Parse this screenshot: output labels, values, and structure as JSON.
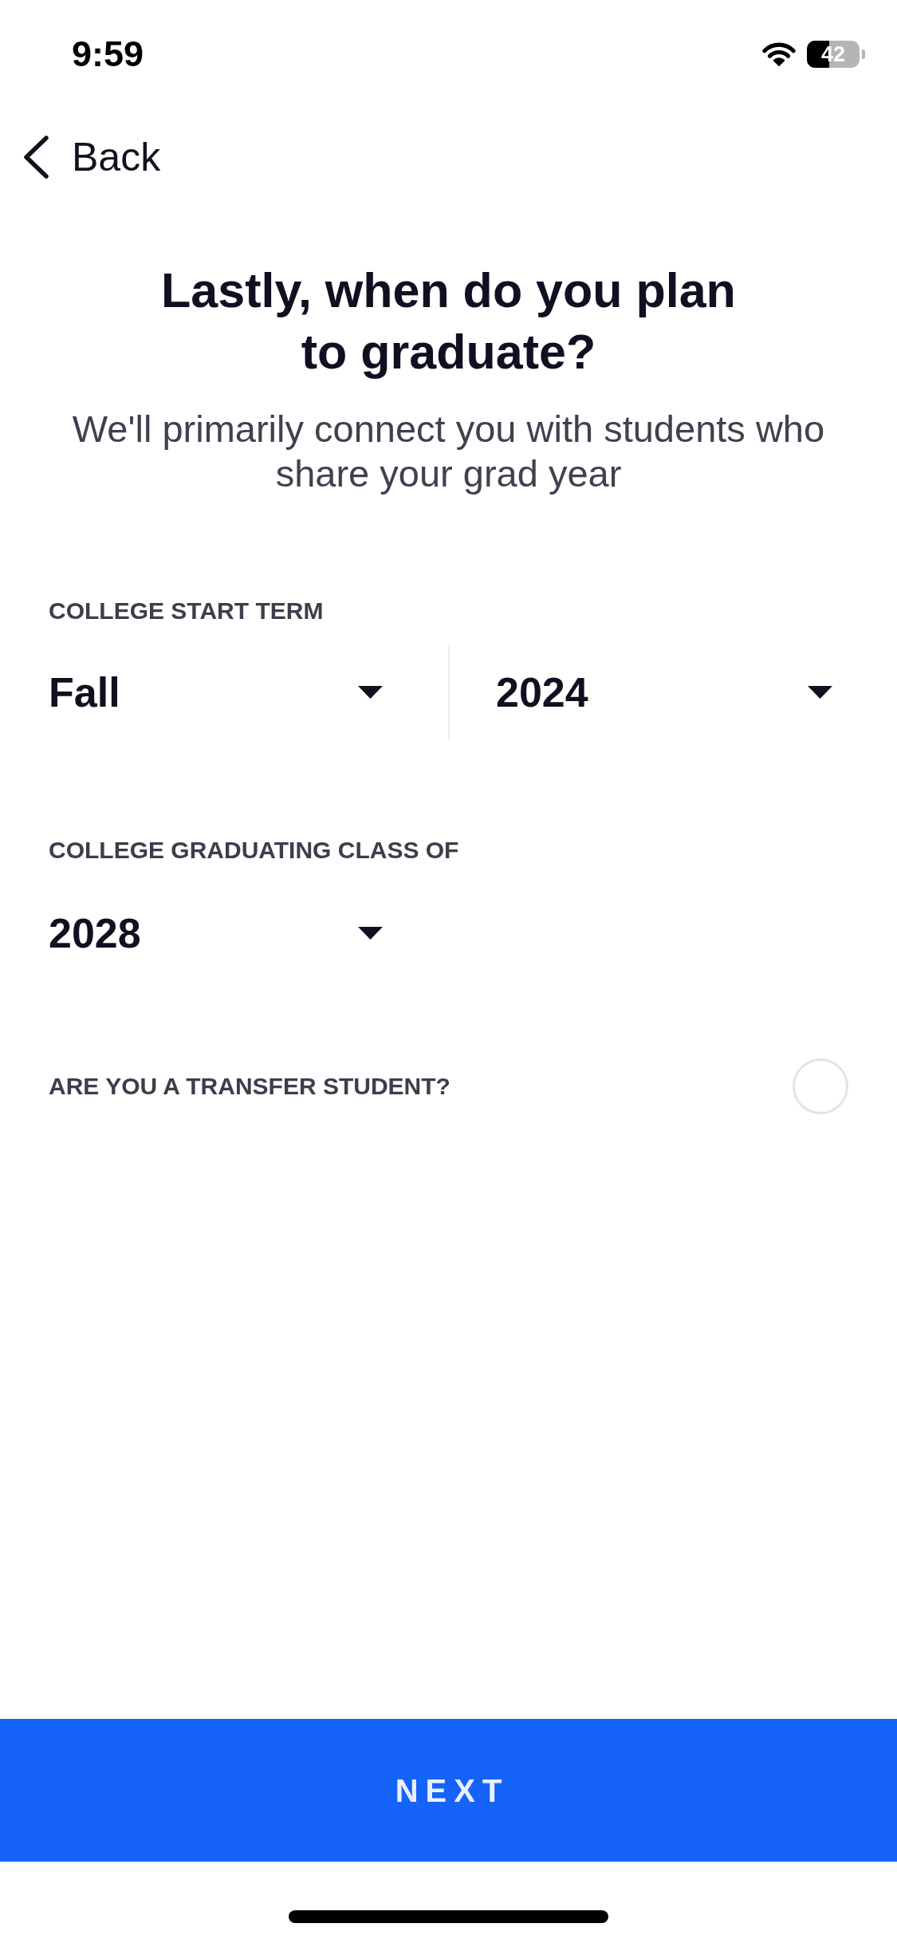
{
  "status_bar": {
    "time": "9:59",
    "battery": "42"
  },
  "nav": {
    "back_label": "Back"
  },
  "heading": {
    "title": "Lastly, when do you plan to graduate?",
    "subtitle": "We'll primarily connect you with students who share your grad year"
  },
  "fields": [
    {
      "label": "COLLEGE START TERM",
      "selects": [
        {
          "value": "Fall"
        },
        {
          "value": "2024"
        }
      ]
    },
    {
      "label": "COLLEGE GRADUATING CLASS OF",
      "selects": [
        {
          "value": "2028"
        }
      ]
    }
  ],
  "transfer": {
    "label": "ARE YOU A TRANSFER STUDENT?",
    "checked": false
  },
  "next_button": {
    "label": "NEXT"
  }
}
